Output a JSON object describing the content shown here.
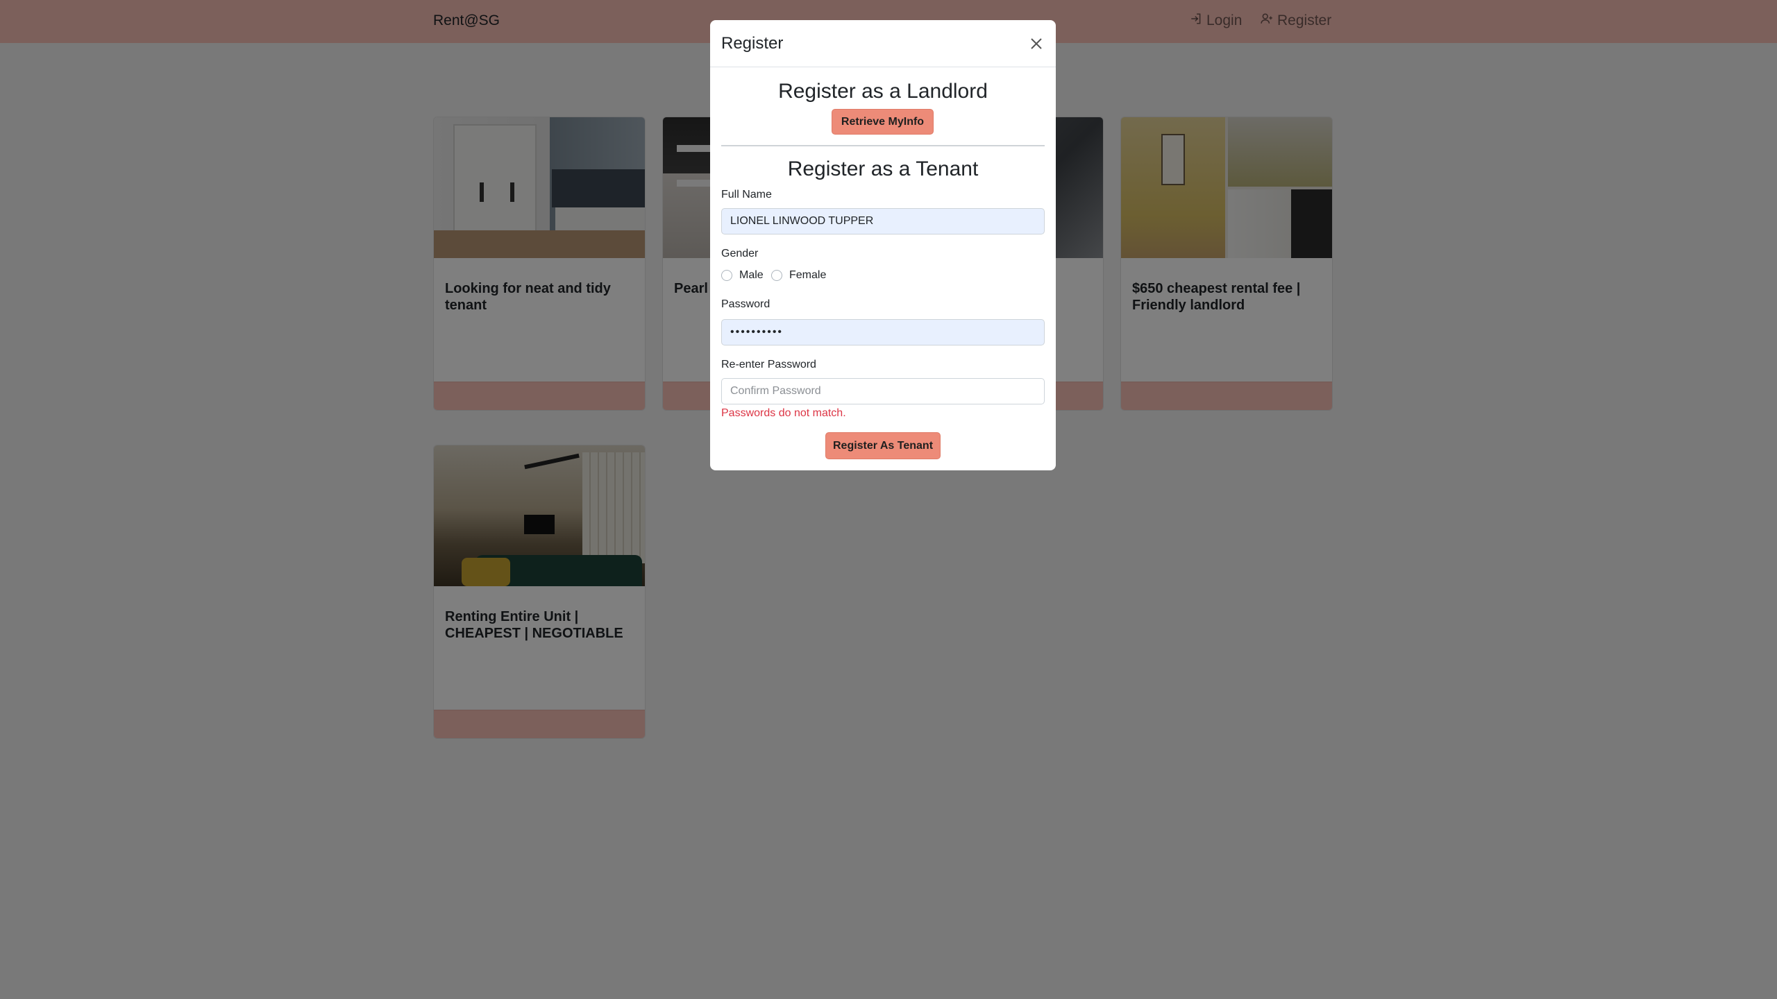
{
  "navbar": {
    "brand": "Rent@SG",
    "login_label": "Login",
    "register_label": "Register",
    "login_icon": "login-icon",
    "register_icon": "user-plus-icon",
    "background_color": "#f9c0b6"
  },
  "listings": [
    {
      "title": "Looking for neat and tidy tenant"
    },
    {
      "title": "Pearl … Femal…"
    },
    {
      "title": ""
    },
    {
      "title": "$650 cheapest rental fee | Friendly landlord"
    },
    {
      "title": "Renting Entire Unit | CHEAPEST | NEGOTIABLE"
    }
  ],
  "modal": {
    "title": "Register",
    "close_icon": "close-icon",
    "landlord": {
      "heading": "Register as a Landlord",
      "myinfo_button": "Retrieve MyInfo"
    },
    "tenant": {
      "heading": "Register as a Tenant",
      "full_name_label": "Full Name",
      "full_name_value": "LIONEL LINWOOD TUPPER",
      "gender_label": "Gender",
      "gender_options": [
        "Male",
        "Female"
      ],
      "password_label": "Password",
      "password_value": "••••••••••",
      "reenter_label": "Re-enter Password",
      "reenter_placeholder": "Confirm Password",
      "error_message": "Passwords do not match.",
      "submit_button": "Register As Tenant"
    },
    "accent_color": "#ed8b78",
    "error_color": "#dc3545"
  }
}
